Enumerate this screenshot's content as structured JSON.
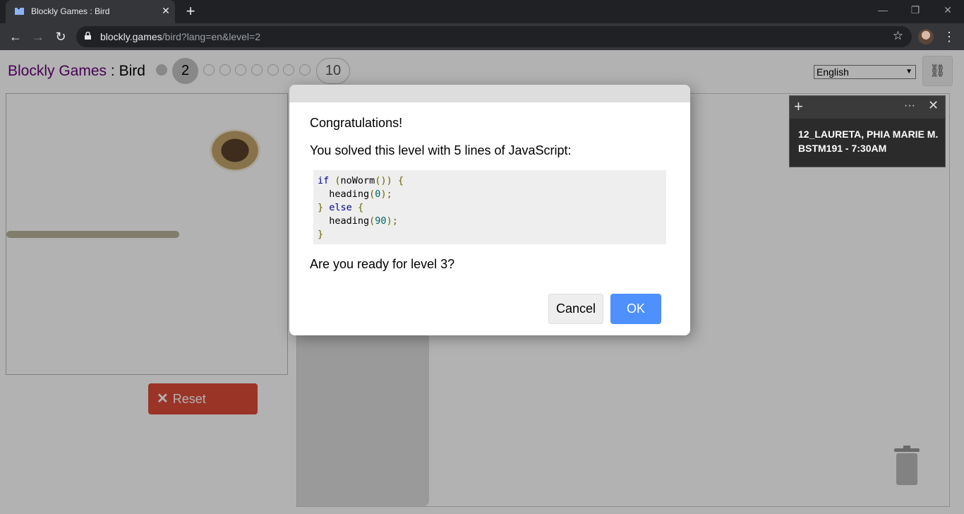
{
  "browser": {
    "tab_title": "Blockly Games : Bird",
    "new_tab_symbol": "+",
    "url_host": "blockly.games",
    "url_path": "/bird?lang=en&level=2"
  },
  "header": {
    "brand": "Blockly Games",
    "separator": " : ",
    "game": "Bird",
    "current_level": "2",
    "last_level": "10"
  },
  "language_select": {
    "selected": "English"
  },
  "reset_label": "Reset",
  "dialog": {
    "congrats": "Congratulations!",
    "summary": "You solved this level with 5 lines of JavaScript:",
    "ready": "Are you ready for level 3?",
    "cancel_label": "Cancel",
    "ok_label": "OK"
  },
  "sticky_note": {
    "line1": "12_LAURETA, PHIA MARIE M.",
    "line2": "BSTM191 - 7:30AM"
  },
  "colors": {
    "brand": "#660077",
    "reset": "#dd4b39",
    "ok": "#4d90fe"
  }
}
